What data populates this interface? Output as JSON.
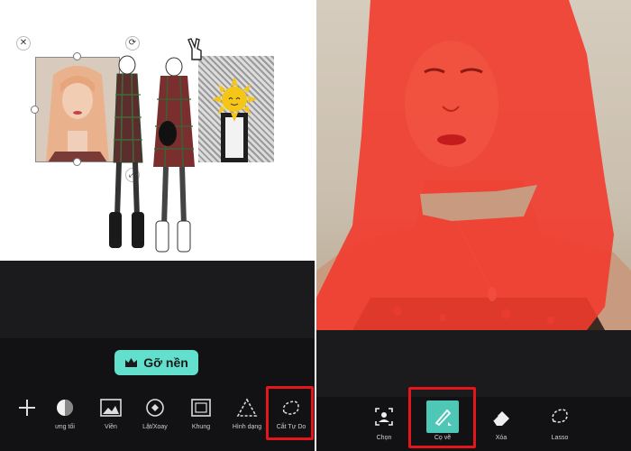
{
  "left_panel": {
    "remove_bg_label": "Gỡ nền",
    "tools": [
      {
        "label": "",
        "icon": "plus-icon"
      },
      {
        "label": "ưng tối",
        "icon": "shadow-icon"
      },
      {
        "label": "Viền",
        "icon": "image-border-icon"
      },
      {
        "label": "Lật/Xoay",
        "icon": "flip-rotate-icon"
      },
      {
        "label": "Khung",
        "icon": "frame-icon"
      },
      {
        "label": "Hình dạng",
        "icon": "shape-triangle-icon"
      },
      {
        "label": "Cắt Tự Do",
        "icon": "freecut-icon"
      }
    ],
    "highlight_color": "#e4151b",
    "accent_color": "#63e0cd"
  },
  "right_panel": {
    "tools": [
      {
        "label": "Chọn",
        "icon": "select-person-icon"
      },
      {
        "label": "Cọ vẽ",
        "icon": "brush-icon"
      },
      {
        "label": "Xóa",
        "icon": "eraser-icon"
      },
      {
        "label": "Lasso",
        "icon": "lasso-icon"
      }
    ],
    "mask_color": "#f23b2e",
    "active_tool_color": "#4fc7b6"
  }
}
